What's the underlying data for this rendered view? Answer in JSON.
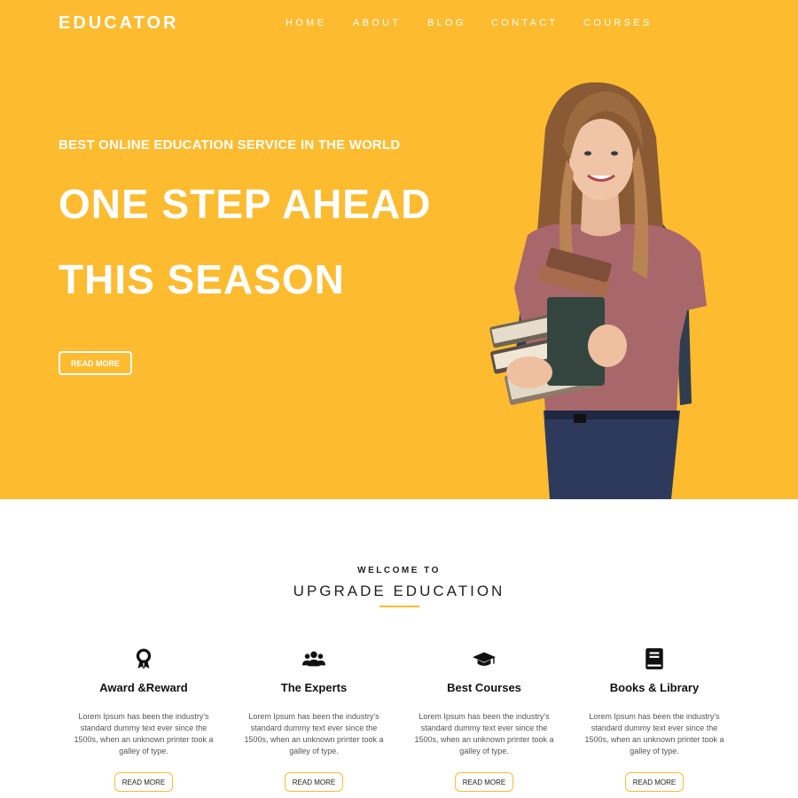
{
  "header": {
    "logo": "EDUCATOR",
    "nav": [
      "HOME",
      "ABOUT",
      "BLOG",
      "CONTACT",
      "COURSES"
    ]
  },
  "hero": {
    "tagline": "BEST ONLINE EDUCATION SERVICE IN THE WORLD",
    "headline_line1": "ONE STEP AHEAD",
    "headline_line2": "THIS SEASON",
    "button_label": "READ MORE"
  },
  "features_section": {
    "eyebrow": "WELCOME TO",
    "title": "UPGRADE EDUCATION",
    "items": [
      {
        "icon": "award-icon",
        "title": "Award &Reward",
        "description": "Lorem Ipsum has been the industry's standard dummy text ever since the 1500s, when an unknown printer took a galley of type.",
        "button_label": "READ MORE"
      },
      {
        "icon": "users-icon",
        "title": "The Experts",
        "description": "Lorem Ipsum has been the industry's standard dummy text ever since the 1500s, when an unknown printer took a galley of type.",
        "button_label": "READ MORE"
      },
      {
        "icon": "graduation-cap-icon",
        "title": "Best Courses",
        "description": "Lorem Ipsum has been the industry's standard dummy text ever since the 1500s, when an unknown printer took a galley of type.",
        "button_label": "READ MORE"
      },
      {
        "icon": "book-icon",
        "title": "Books & Library",
        "description": "Lorem Ipsum has been the industry's standard dummy text ever since the 1500s, when an unknown printer took a galley of type.",
        "button_label": "READ MORE"
      }
    ]
  },
  "colors": {
    "accent": "#FDBB30",
    "text_dark": "#222222",
    "text_muted": "#555555"
  }
}
